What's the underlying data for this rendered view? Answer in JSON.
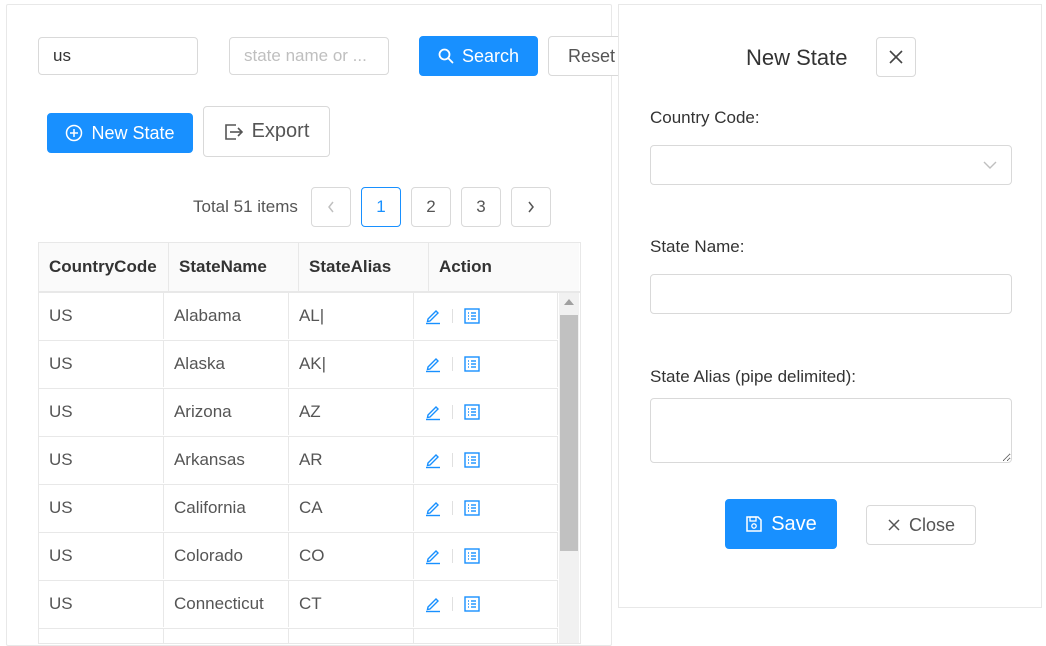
{
  "search": {
    "country_value": "us",
    "state_placeholder": "state name or ...",
    "search_label": "Search",
    "reset_label": "Reset"
  },
  "toolbar": {
    "new_state_label": "New State",
    "export_label": "Export"
  },
  "pagination": {
    "total": "Total 51 items",
    "pages": [
      "1",
      "2",
      "3"
    ],
    "current": "1"
  },
  "table": {
    "columns": [
      "CountryCode",
      "StateName",
      "StateAlias",
      "Action"
    ],
    "rows": [
      [
        "US",
        "Alabama",
        "AL|"
      ],
      [
        "US",
        "Alaska",
        "AK|"
      ],
      [
        "US",
        "Arizona",
        "AZ"
      ],
      [
        "US",
        "Arkansas",
        "AR"
      ],
      [
        "US",
        "California",
        "CA"
      ],
      [
        "US",
        "Colorado",
        "CO"
      ],
      [
        "US",
        "Connecticut",
        "CT"
      ],
      [
        "",
        "",
        ""
      ]
    ]
  },
  "drawer": {
    "title": "New State",
    "country_code_label": "Country Code:",
    "state_name_label": "State Name:",
    "state_alias_label": "State Alias (pipe delimited):",
    "save_label": "Save",
    "close_label": "Close"
  },
  "colors": {
    "primary": "#1890ff",
    "border": "#d9d9d9"
  }
}
